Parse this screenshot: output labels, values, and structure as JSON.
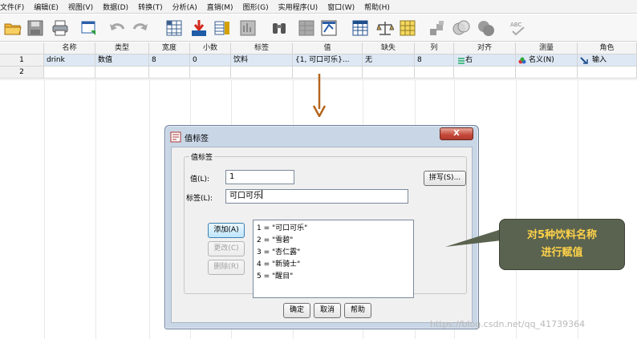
{
  "menubar": {
    "items": [
      "文件(F)",
      "编辑(E)",
      "视图(V)",
      "数据(D)",
      "转换(T)",
      "分析(A)",
      "直销(M)",
      "图形(G)",
      "实用程序(U)",
      "窗口(W)",
      "帮助(H)"
    ]
  },
  "toolbar": {
    "icons": [
      "open-folder-icon",
      "save-icon",
      "print-icon",
      "dialog-recall-icon",
      "undo-icon",
      "redo-icon",
      "goto-case-icon",
      "goto-variable-icon",
      "variables-icon",
      "run-descriptives-icon",
      "find-icon",
      "insert-cases-icon",
      "insert-variable-icon",
      "split-file-icon",
      "weight-cases-icon",
      "select-cases-icon",
      "value-labels-icon",
      "use-variable-sets-icon",
      "show-all-variables-icon",
      "spelling-icon"
    ],
    "spelling_text": "ABC"
  },
  "grid": {
    "headers": [
      "名称",
      "类型",
      "宽度",
      "小数",
      "标签",
      "值",
      "缺失",
      "列",
      "对齐",
      "测量",
      "角色"
    ],
    "rows": [
      {
        "num": "1",
        "cells": [
          "drink",
          "数值",
          "8",
          "0",
          "饮料",
          "{1, 可口可乐}...",
          "无",
          "8",
          "右",
          "名义(N)",
          "输入"
        ]
      },
      {
        "num": "2",
        "cells": [
          "",
          "",
          "",
          "",
          "",
          "",
          "",
          "",
          "",
          "",
          ""
        ]
      }
    ]
  },
  "dialog": {
    "title": "值标签",
    "close_label": "X",
    "group_label": "值标签",
    "value_label": "值(L):",
    "value_input": "1",
    "label_label": "标签(L):",
    "label_input": "可口可乐",
    "spelling_button": "拼写(S)...",
    "add_button": "添加(A)",
    "change_button": "更改(C)",
    "remove_button": "删除(R)",
    "list_items": [
      "1 = \"可口可乐\"",
      "2 = \"雪碧\"",
      "3 = \"杏仁露\"",
      "4 = \"新骑士\"",
      "5 = \"醒目\""
    ],
    "ok_button": "确定",
    "cancel_button": "取消",
    "help_button": "帮助"
  },
  "callout": {
    "line1": "对5种饮料名称",
    "line2": "进行赋值"
  },
  "watermark": "https://blog.csdn.net/qq_41739364",
  "colors": {
    "callout_bg": "#5a634f",
    "callout_text": "#ffd24a",
    "arrow": "#b5651d",
    "dialog_frame": "#c9d6e6"
  }
}
